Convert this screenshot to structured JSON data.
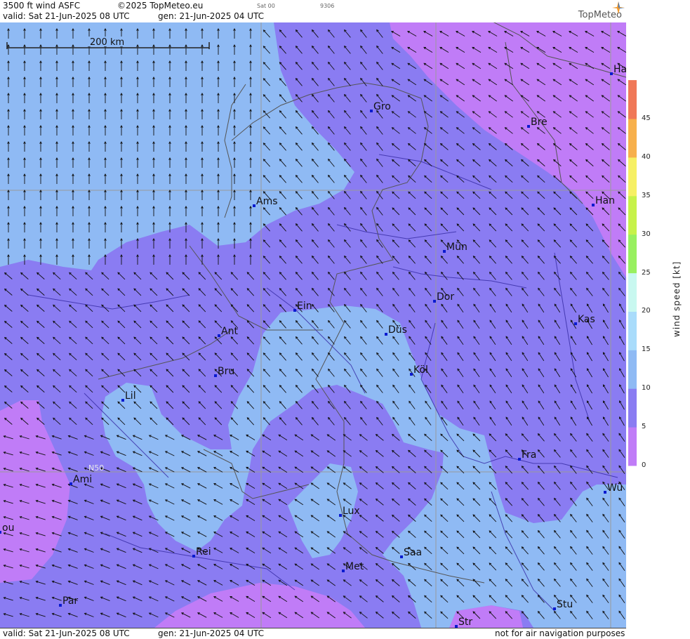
{
  "header": {
    "product": "3500 ft wind ASFC",
    "copyright": "©2025 TopMeteo.eu",
    "sat_code": "Sat 00",
    "id_code": "9306",
    "valid": "valid:  Sat  21-Jun-2025  08 UTC",
    "gen": "gen: 21-Jun-2025 04 UTC",
    "logo": "TopMeteo"
  },
  "footer": {
    "valid": "valid:  Sat  21-Jun-2025  08 UTC",
    "gen": "gen: 21-Jun-2025 04 UTC",
    "disclaimer": "not for air navigation purposes"
  },
  "scale_bar": {
    "label": "200 km"
  },
  "grid_label": "N50",
  "cities": [
    {
      "name": "Gro"
    },
    {
      "name": "Bre"
    },
    {
      "name": "Ha"
    },
    {
      "name": "Ams"
    },
    {
      "name": "Han"
    },
    {
      "name": "Mün"
    },
    {
      "name": "Ein"
    },
    {
      "name": "Dor"
    },
    {
      "name": "Kas"
    },
    {
      "name": "Ant"
    },
    {
      "name": "Düs"
    },
    {
      "name": "Bru"
    },
    {
      "name": "Köl"
    },
    {
      "name": "Lil"
    },
    {
      "name": "Fra"
    },
    {
      "name": "Ami"
    },
    {
      "name": "Wü"
    },
    {
      "name": "Lux"
    },
    {
      "name": "ou"
    },
    {
      "name": "Rei"
    },
    {
      "name": "Saa"
    },
    {
      "name": "Met"
    },
    {
      "name": "Par"
    },
    {
      "name": "Stu"
    },
    {
      "name": "Str"
    }
  ],
  "colorbar": {
    "title": "wind  speed  [kt]",
    "ticks": [
      "45",
      "40",
      "35",
      "30",
      "25",
      "20",
      "15",
      "10",
      "5",
      "0"
    ],
    "range": [
      0,
      45
    ],
    "colors": [
      "#c07cf7",
      "#8a7cf2",
      "#8fbaf4",
      "#a9dcfb",
      "#c8f8f0",
      "#98f060",
      "#c6f24a",
      "#f6f064",
      "#f7b04c",
      "#f07858"
    ]
  },
  "legend_colors": {
    "0-5": "#c07cf7",
    "5-10": "#8a7cf2",
    "10-15": "#8fbaf4"
  }
}
